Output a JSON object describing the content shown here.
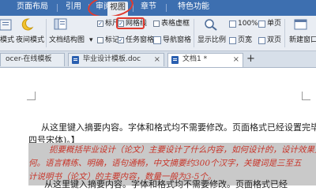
{
  "ribbon_tabs": [
    "页面布局",
    "引用",
    "审阅",
    "视图",
    "章节",
    "特色功能"
  ],
  "active_tab": "视图",
  "ribbon": {
    "mode_label": "模式",
    "night_mode": "夜间模式",
    "doc_structure": "文档结构图",
    "ruler": "标尺",
    "gridlines": "网格线",
    "table_grid": "表格虚框",
    "markup": "标记",
    "task_pane": "任务窗格",
    "nav_pane": "导航窗格",
    "zoom_btn": "显示比例",
    "zoom_value": "100%",
    "one_page": "单页",
    "page_width": "页宽",
    "two_pages": "双页",
    "new_window": "新建窗口"
  },
  "doc_tabs": [
    {
      "title": "ocer-在线模板"
    },
    {
      "title": "毕业设计模板.doc"
    },
    {
      "title": "文档1 *"
    }
  ],
  "doc": {
    "line1": "从这里键入摘要内容。字体和格式均不需要修改。页面格式已经设置完毕(小",
    "line2": "四号宋体)。】",
    "hl1": "扼要概括毕业设计（论文）主要设计了什么内容，如何设计的，设计效果如",
    "hl2": "何。语言精练、明确，语句通畅，中文摘要约300个汉字，关键词是三至五",
    "hl3": "计说明书（论文）的主要内容，数量一般为3-5个。",
    "line3": "从这里键入摘要内容。字体和格式均不需要修改。页面格式已经"
  },
  "colors": {
    "accent": "#3d6fb0",
    "highlight_text": "#c8352a",
    "circle": "#e03a2f"
  }
}
